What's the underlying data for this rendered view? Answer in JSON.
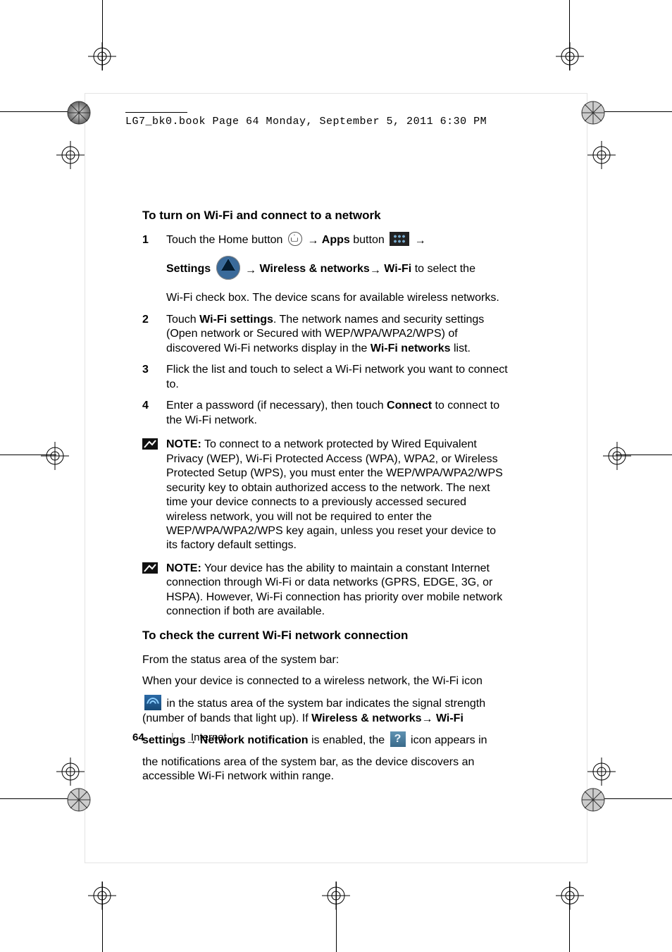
{
  "header_stamp": "LG7_bk0.book  Page 64  Monday, September 5, 2011  6:30 PM",
  "section1": {
    "title": "To turn on Wi-Fi and connect to a network",
    "steps": [
      {
        "n": "1",
        "l1a": "Touch the Home button ",
        "l1b": " Apps",
        "l1c": " button ",
        "l2a": "Settings ",
        "l2b": " Wireless & networks",
        "l2c": " Wi-Fi",
        "l2d": " to select the",
        "l3": "Wi-Fi check box. The device scans for available wireless networks."
      },
      {
        "n": "2",
        "t1": "Touch ",
        "t1b": "Wi-Fi settings",
        "t2": ". The network names and security settings (Open network or Secured with WEP/WPA/WPA2/WPS) of discovered Wi-Fi networks display in the ",
        "t2b": "Wi-Fi networks",
        "t3": " list."
      },
      {
        "n": "3",
        "t": "Flick the list and touch to select a Wi-Fi network you want to connect to."
      },
      {
        "n": "4",
        "t1": "Enter a password (if necessary), then touch ",
        "t1b": "Connect",
        "t2": " to connect to the Wi-Fi network."
      }
    ]
  },
  "note1": {
    "label": "NOTE:",
    "text": " To connect to a network protected by Wired Equivalent Privacy (WEP), Wi-Fi Protected Access (WPA), WPA2, or Wireless Protected Setup (WPS), you must enter the WEP/WPA/WPA2/WPS security key to obtain authorized access to the network. The next time your device connects to a previously accessed secured wireless network, you will not be required to enter the WEP/WPA/WPA2/WPS key again, unless you reset your device to its factory default settings."
  },
  "note2": {
    "label": "NOTE:",
    "text": " Your device has the ability to maintain a constant Internet connection through Wi-Fi or data networks (GPRS, EDGE, 3G, or HSPA). However, Wi-Fi connection has priority over mobile network connection if both are available."
  },
  "section2": {
    "title": "To check the current Wi-Fi network connection",
    "p1": "From the status area of the system bar:",
    "p2": "When your device is connected to a wireless network, the Wi-Fi icon",
    "p3a": " in the status area of the system bar indicates the signal strength",
    "p3b": "(number of bands that light up). If ",
    "p3c": "Wireless & networks",
    "p3d": " Wi-Fi ",
    "p4a": "settings",
    "p4b": " Network notification",
    "p4c": " is enabled, the ",
    "p4d": " icon appears in",
    "p5": "the notifications area of the system bar, as the device discovers an accessible Wi-Fi network within range."
  },
  "footer": {
    "page": "64",
    "chapter": "Internet"
  },
  "glyphs": {
    "arrow": "→"
  }
}
